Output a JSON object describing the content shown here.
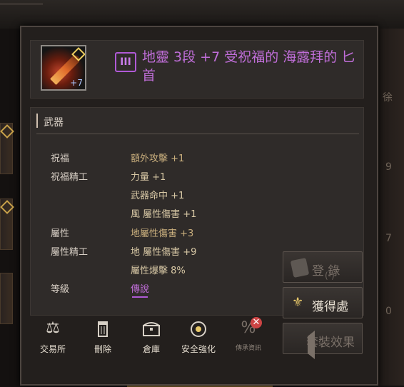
{
  "item": {
    "tier_badge": "III",
    "enhance_level": "+7",
    "name": "地靈 3段 +7 受祝福的 海露拜的 匕首"
  },
  "category": "武器",
  "stats": [
    {
      "label": "祝福",
      "value": "額外攻擊 +1"
    },
    {
      "label": "祝福精工",
      "value": "力量 +1"
    },
    {
      "label": "",
      "value": "武器命中 +1"
    },
    {
      "label": "",
      "value": "風 屬性傷害 +1"
    },
    {
      "label": "屬性",
      "value": "地屬性傷害  +3"
    },
    {
      "label": "屬性精工",
      "value": "地 屬性傷害 +9"
    },
    {
      "label": "",
      "value": "屬性爆擊 8%"
    },
    {
      "label": "等級",
      "value": "傳說"
    }
  ],
  "side_buttons": {
    "register": "登 錄",
    "register_sub": "(-)",
    "obtain": "獲得處",
    "set_effect": "套裝效果"
  },
  "toolbar": [
    {
      "label": "交易所",
      "icon": "scale-icon"
    },
    {
      "label": "刪除",
      "icon": "trash-icon"
    },
    {
      "label": "倉庫",
      "icon": "chest-icon"
    },
    {
      "label": "安全強化",
      "icon": "enhance-icon"
    },
    {
      "label": "傳承資訊",
      "icon": "inherit-disabled-icon"
    }
  ],
  "colors": {
    "legendary": "#c06ed9",
    "panel": "#231f1d",
    "text": "#d9d0c6"
  }
}
